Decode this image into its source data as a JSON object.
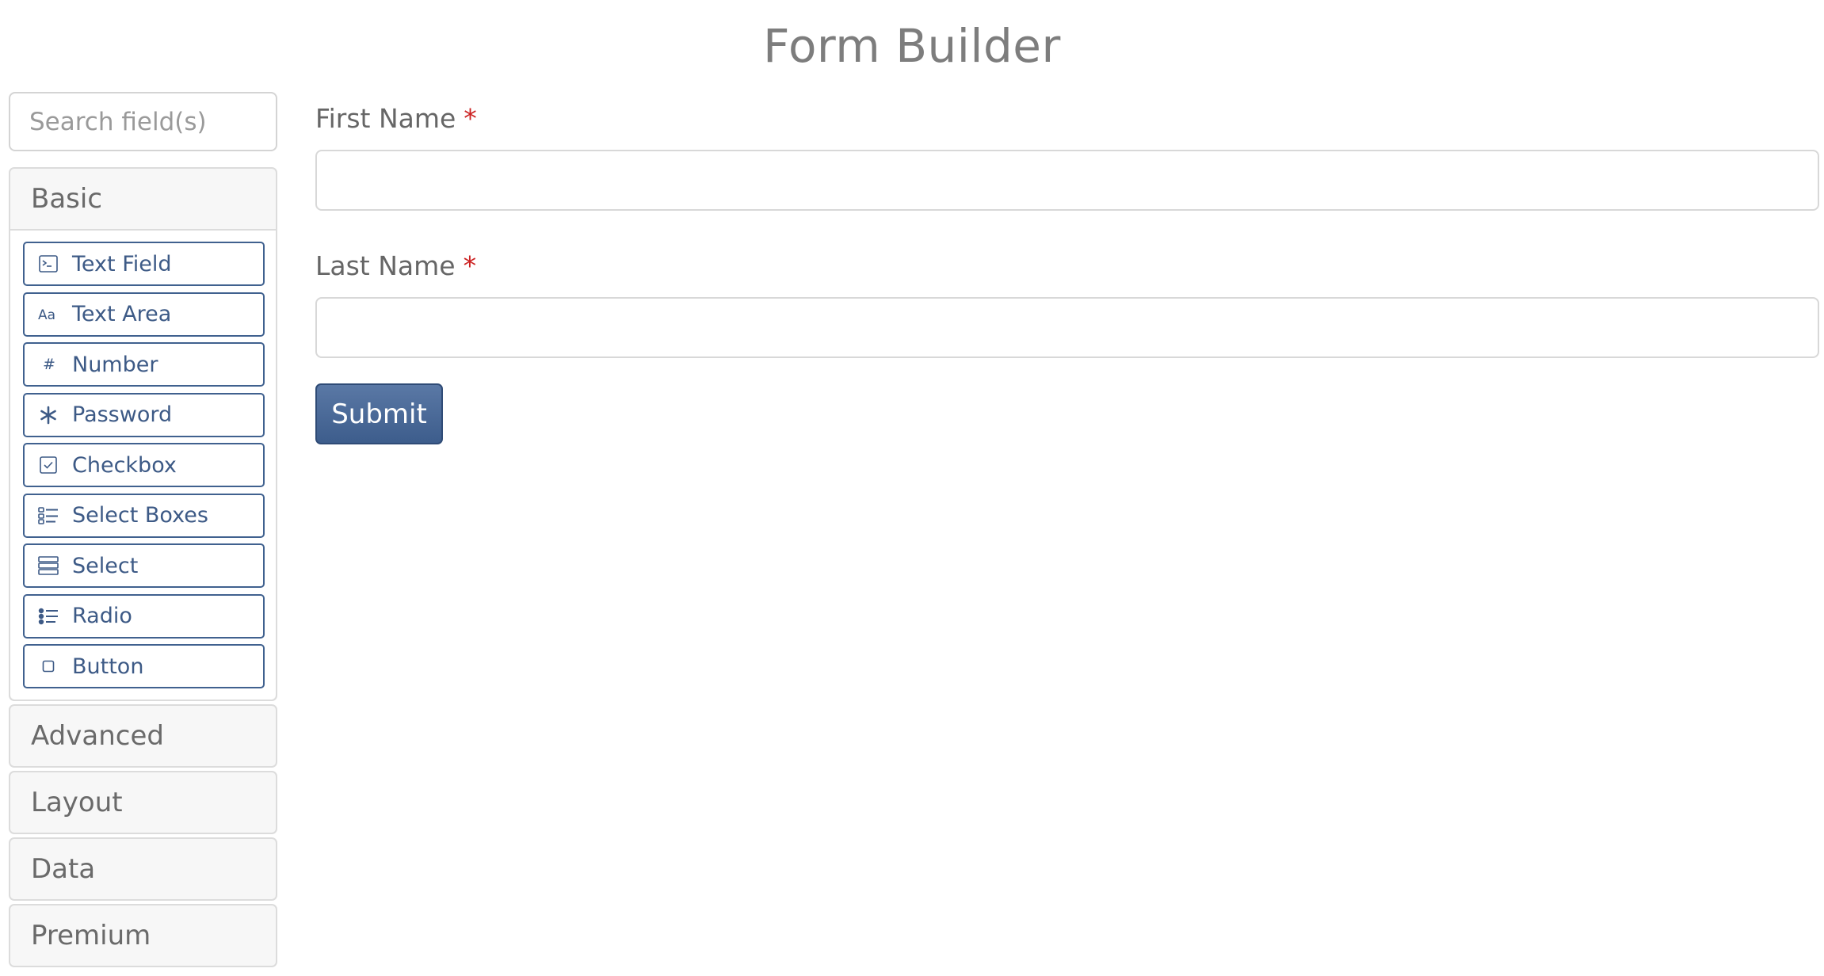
{
  "page": {
    "title": "Form Builder"
  },
  "sidebar": {
    "search_placeholder": "Search field(s)",
    "groups": [
      {
        "label": "Basic",
        "items": [
          {
            "label": "Text Field",
            "icon": "terminal-icon"
          },
          {
            "label": "Text Area",
            "icon": "font-icon"
          },
          {
            "label": "Number",
            "icon": "hashtag-icon"
          },
          {
            "label": "Password",
            "icon": "asterisk-icon"
          },
          {
            "label": "Checkbox",
            "icon": "check-square-icon"
          },
          {
            "label": "Select Boxes",
            "icon": "tasks-icon"
          },
          {
            "label": "Select",
            "icon": "th-list-icon"
          },
          {
            "label": "Radio",
            "icon": "list-ul-icon"
          },
          {
            "label": "Button",
            "icon": "stop-icon"
          }
        ]
      },
      {
        "label": "Advanced"
      },
      {
        "label": "Layout"
      },
      {
        "label": "Data"
      },
      {
        "label": "Premium"
      }
    ]
  },
  "form": {
    "fields": [
      {
        "label": "First Name",
        "required_mark": "*",
        "value": ""
      },
      {
        "label": "Last Name",
        "required_mark": "*",
        "value": ""
      }
    ],
    "submit_label": "Submit"
  },
  "colors": {
    "accent": "#3d5a86",
    "submit_bg": "#4a6a98",
    "required": "#cc2222",
    "title": "#7d7d7d"
  }
}
